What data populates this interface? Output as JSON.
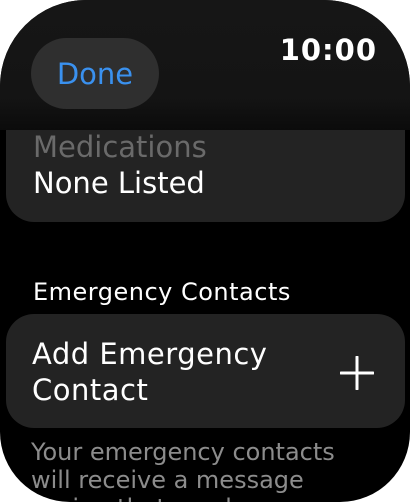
{
  "header": {
    "done_label": "Done",
    "time": "10:00"
  },
  "medications": {
    "label": "Medications",
    "value": "None Listed"
  },
  "emergency_contacts": {
    "section_title": "Emergency Contacts",
    "add_label": "Add Emergency Contact",
    "add_icon": "plus-icon",
    "footer": "Your emergency contacts will receive a message saying that you have..."
  },
  "colors": {
    "accent": "#3a91ef",
    "background": "#000000",
    "card": "#232323"
  }
}
